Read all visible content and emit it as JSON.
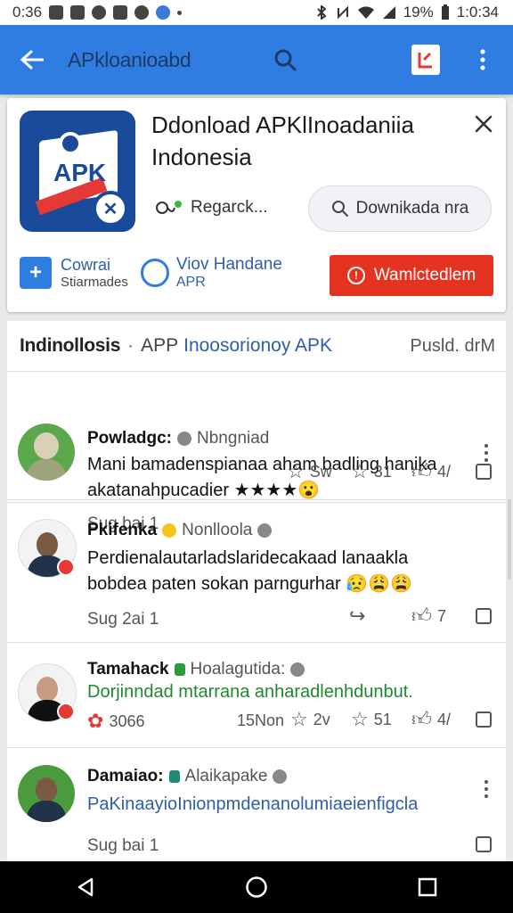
{
  "status_bar": {
    "time_left": "0:36",
    "battery": "19%",
    "time_right": "1:0:34"
  },
  "app_bar": {
    "title": "APkloanioabd"
  },
  "app_card": {
    "title": "Ddonload APKlInoadaniia Indonesia",
    "regards_label": "Regarck...",
    "download_pill_label": "Downikada nra",
    "action1_line1": "Cowrai",
    "action1_line2": "Stiarmades",
    "action2_line1": "Viov Handane",
    "action2_line2": "APR",
    "red_button_label": "Wamlctedlem",
    "colors": {
      "accent": "#2f7de1",
      "danger": "#e53322",
      "logo_bg": "#1a4a9a"
    }
  },
  "feed": {
    "header_title": "Indinollosis",
    "header_sep": "·",
    "header_app": "APP",
    "header_link": "Inoosorionoy APK",
    "header_right": "Pusld. drM",
    "posts": [
      {
        "name": "Powladgc:",
        "subtitle": "Nbngniad",
        "text": "Mani bamadenspianaa aham badling hanika akatanahpucadier ★★★★😮",
        "footer": "Sug bai  1",
        "metrics": [
          "Sw",
          "31",
          "4/"
        ]
      },
      {
        "name": "Pkifenka",
        "subtitle": "Nonlloola",
        "text": "Perdienalautarladslaridecakaad lanaakla bobdea paten sokan parngurhar 😥😩😩",
        "footer": "Sug 2ai  1",
        "metrics": [
          "7"
        ]
      },
      {
        "name": "Tamahack",
        "subtitle": "Hoalagutida:",
        "text": "Dorjinndad mtarrana anharadlenhdunbut.",
        "footer": "",
        "metrics": [
          "3066",
          "15Non",
          "2v",
          "51",
          "4/"
        ]
      },
      {
        "name": "Damaiao:",
        "subtitle": "Alaikapake",
        "text": "PaKinaayioInionpmdenanolumiaeienfigcla",
        "footer": "Sug bai  1",
        "metrics": []
      }
    ]
  }
}
